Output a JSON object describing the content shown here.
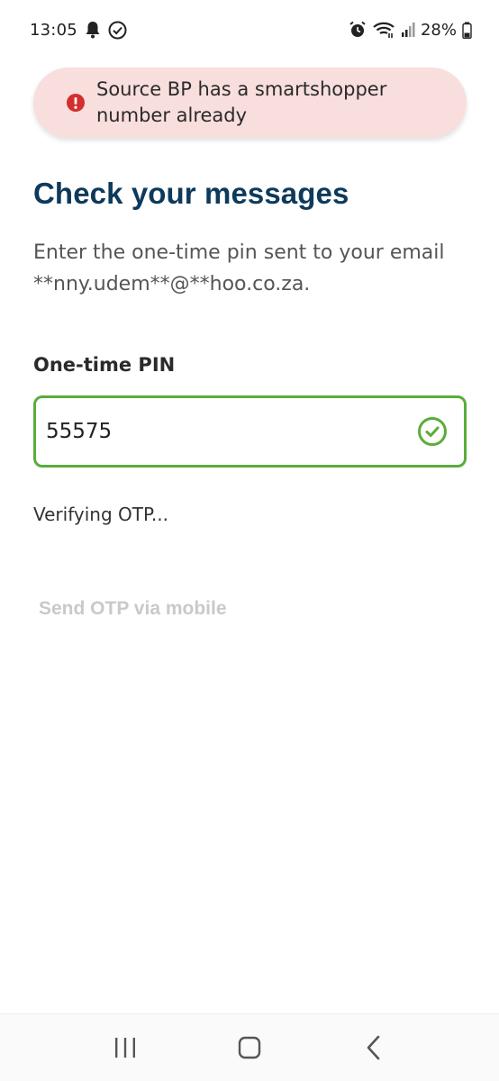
{
  "status_bar": {
    "time": "13:05",
    "battery": "28%",
    "icons": [
      "bell-icon",
      "check-circle-icon",
      "alarm-icon",
      "wifi-icon",
      "signal-icon",
      "battery-icon"
    ]
  },
  "toast": {
    "message": "Source BP has a smartshopper number already",
    "icon": "error-icon",
    "color": "#d32f2f",
    "background": "#f8dedc"
  },
  "page": {
    "title": "Check your messages",
    "description": "Enter the one-time pin sent to your email **nny.udem**@**hoo.co.za."
  },
  "pin_field": {
    "label": "One-time PIN",
    "value": "55575",
    "status_icon": "check-circle-icon",
    "valid_color": "#5aad3a"
  },
  "status_text": "Verifying OTP...",
  "send_otp_label": "Send OTP via mobile",
  "nav_bar": {
    "buttons": [
      "recent-apps-icon",
      "home-icon",
      "back-icon"
    ]
  }
}
